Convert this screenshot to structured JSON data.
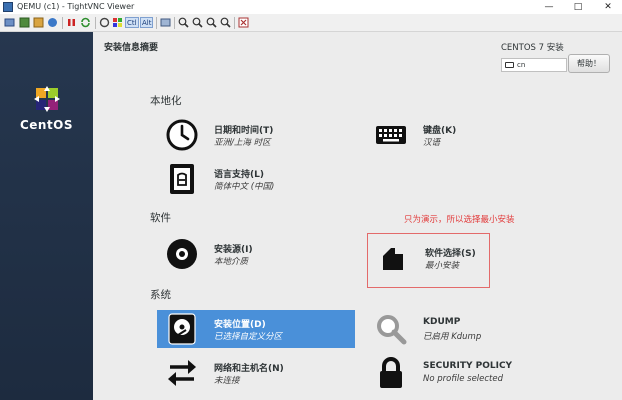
{
  "window": {
    "title": "QEMU (c1) - TightVNC Viewer",
    "controls": {
      "minimize": "—",
      "maximize": "□",
      "close": "✕"
    }
  },
  "toolbar": {
    "ctrl_label": "Ctl",
    "alt_label": "Alt"
  },
  "sidebar": {
    "brand": "CentOS"
  },
  "header": {
    "title": "安装信息摘要",
    "product": "CENTOS 7 安装",
    "keyboard_layout": "cn",
    "help_label": "帮助！"
  },
  "sections": {
    "localization": {
      "label": "本地化",
      "datetime": {
        "title": "日期和时间(T)",
        "status": "亚洲/上海 时区",
        "icon": "clock-icon"
      },
      "keyboard": {
        "title": "键盘(K)",
        "status": "汉语",
        "icon": "keyboard-icon"
      },
      "language": {
        "title": "语言支持(L)",
        "status": "简体中文 (中国)",
        "icon": "language-icon"
      }
    },
    "software": {
      "label": "软件",
      "source": {
        "title": "安装源(I)",
        "status": "本地介质",
        "icon": "disc-icon"
      },
      "selection": {
        "title": "软件选择(S)",
        "status": "最小安装",
        "icon": "package-icon"
      }
    },
    "system": {
      "label": "系统",
      "destination": {
        "title": "安装位置(D)",
        "status": "已选择自定义分区",
        "icon": "harddisk-icon"
      },
      "kdump": {
        "title": "KDUMP",
        "status": "已启用 Kdump",
        "icon": "magnifier-icon"
      },
      "network": {
        "title": "网络和主机名(N)",
        "status": "未连接",
        "icon": "network-arrows-icon"
      },
      "security": {
        "title": "SECURITY POLICY",
        "status": "No profile selected",
        "icon": "padlock-icon"
      }
    }
  },
  "annotation": {
    "text": "只为演示，所以选择最小安装",
    "color": "#e23b3b"
  },
  "colors": {
    "sidebar": "#26374f",
    "selected": "#4a90d9",
    "background": "#ececec"
  }
}
